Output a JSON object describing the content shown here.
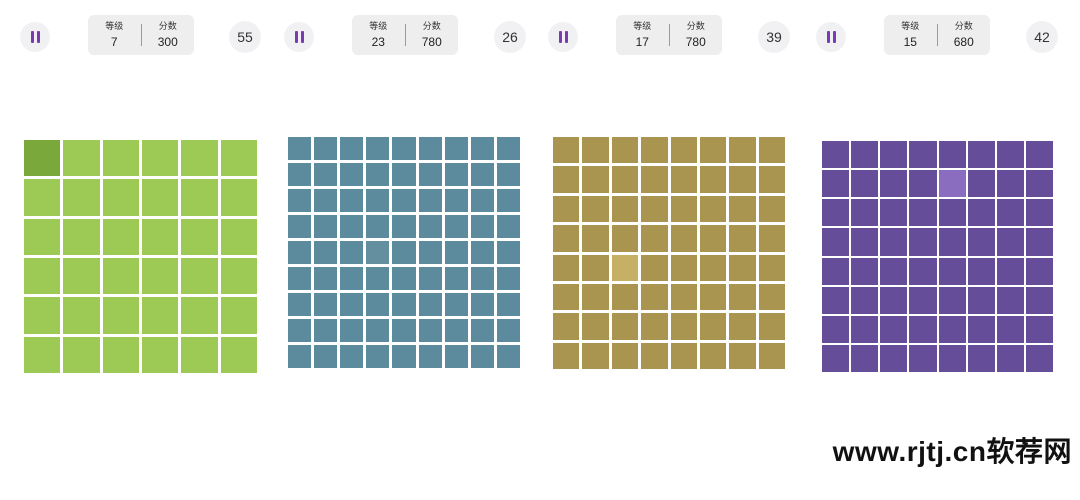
{
  "labels": {
    "level": "等级",
    "score": "分数"
  },
  "games": [
    {
      "level": "7",
      "score": "300",
      "timer": "55",
      "grid_size": 6,
      "tile_color": "#9dca55",
      "odd_color": "#7aa83a",
      "odd_index": 0,
      "border_color": "#ffffff",
      "board_background": "#ffffff"
    },
    {
      "level": "23",
      "score": "780",
      "timer": "26",
      "grid_size": 9,
      "tile_color": "#5b8b9c",
      "odd_color": "#638f9f",
      "odd_index": 39,
      "border_color": "#ffffff",
      "board_background": "#5b8b9c"
    },
    {
      "level": "17",
      "score": "780",
      "timer": "39",
      "grid_size": 8,
      "tile_color": "#aa9550",
      "odd_color": "#c6b066",
      "odd_index": 34,
      "border_color": "#ffffff",
      "board_background": "#aa9550"
    },
    {
      "level": "15",
      "score": "680",
      "timer": "42",
      "grid_size": 8,
      "tile_color": "#664d99",
      "odd_color": "#8a6dbf",
      "odd_index": 12,
      "border_color": "#ffffff",
      "board_background": "#664d99"
    }
  ],
  "watermark": "www.rjtj.cn软荐网",
  "accent_color": "#7a39b5"
}
